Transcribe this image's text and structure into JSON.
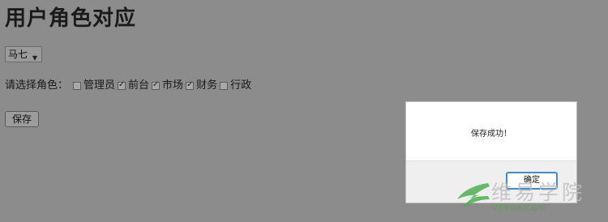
{
  "page": {
    "title": "用户角色对应"
  },
  "user_select": {
    "selected": "马七"
  },
  "roles": {
    "label": "请选择角色：",
    "items": [
      {
        "label": "管理员",
        "checked": false
      },
      {
        "label": "前台",
        "checked": true
      },
      {
        "label": "市场",
        "checked": true
      },
      {
        "label": "财务",
        "checked": true
      },
      {
        "label": "行政",
        "checked": false
      }
    ]
  },
  "actions": {
    "save_label": "保存"
  },
  "dialog": {
    "message": "保存成功！",
    "confirm_label": "确定"
  },
  "watermark": {
    "cn_text": "维易学院",
    "en_text": "VEPHP.COM",
    "logo_color": "#4caf50"
  },
  "colors": {
    "overlay_bg": "#8c8c8c",
    "dialog_bg": "#ffffff",
    "confirm_border": "#3b8fd9"
  }
}
